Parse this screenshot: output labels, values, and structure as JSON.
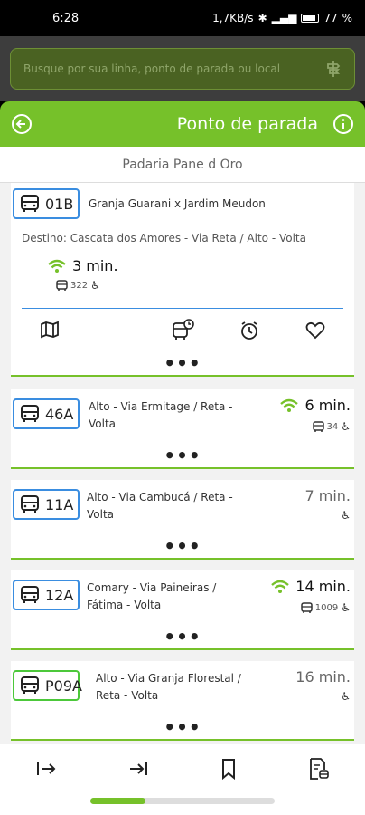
{
  "status": {
    "time": "6:28",
    "network_speed": "1,7KB/s",
    "battery": "77"
  },
  "search": {
    "placeholder": "Busque por sua linha, ponto de parada ou local"
  },
  "header": {
    "title": "Ponto de parada"
  },
  "stop": {
    "name": "Padaria Pane d Oro"
  },
  "routes": [
    {
      "code": "01B",
      "name": "Granja Guarani x Jardim Meudon",
      "destination": "Destino: Cascata dos Amores - Via Reta / Alto - Volta",
      "eta": "3 min.",
      "vehicle": "322",
      "expanded": true
    },
    {
      "code": "46A",
      "name_line1": "Alto - Via Ermitage / Reta -",
      "name_line2": "Volta",
      "eta": "6 min.",
      "vehicle": "34",
      "realtime": true
    },
    {
      "code": "11A",
      "name_line1": "Alto - Via Cambucá / Reta -",
      "name_line2": "Volta",
      "eta": "7 min.",
      "realtime": false
    },
    {
      "code": "12A",
      "name_line1": "Comary - Via Paineiras /",
      "name_line2": "Fátima - Volta",
      "eta": "14 min.",
      "vehicle": "1009",
      "realtime": true
    },
    {
      "code": "P09A",
      "name_line1": "Alto - Via Granja Florestal /",
      "name_line2": "Reta - Volta",
      "eta": "16 min.",
      "realtime": false
    }
  ],
  "home_indicator": {
    "progress": 0.3
  },
  "colors": {
    "accent": "#76c12a",
    "badge_blue": "#3a8de0",
    "badge_green": "#4cc83a"
  }
}
